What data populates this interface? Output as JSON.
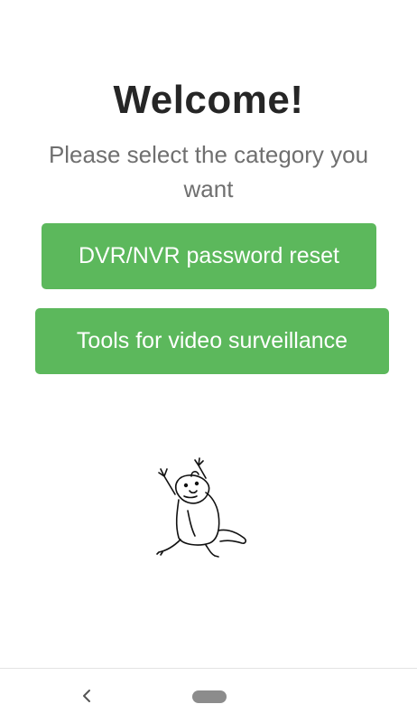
{
  "welcome": {
    "title": "Welcome!",
    "subtitle": "Please select the category you want"
  },
  "buttons": {
    "password_reset": "DVR/NVR password reset",
    "tools": "Tools for video surveillance"
  },
  "colors": {
    "button_green": "#5cb85c",
    "title_text": "#262626",
    "subtitle_text": "#6f6f6f"
  },
  "mascot": {
    "icon": "cheering-hamster-icon"
  },
  "navigation": {
    "back_icon": "back-chevron-icon",
    "home_icon": "home-pill-icon"
  }
}
